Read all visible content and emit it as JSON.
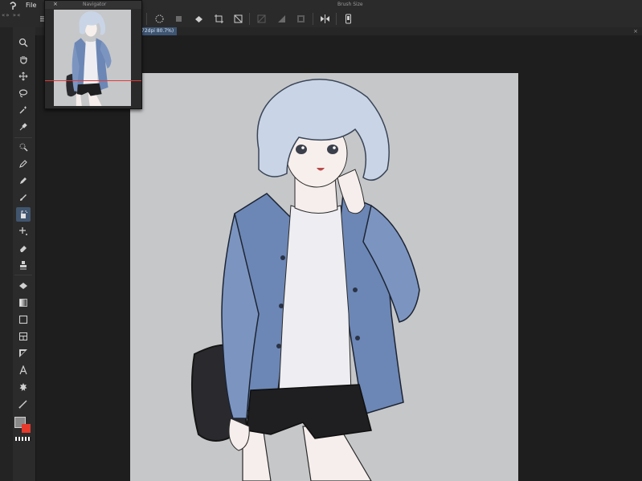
{
  "menubar": {
    "logo_icon": "clip-studio-logo-icon",
    "file_label": "File",
    "brush_size_title": "Brush Size"
  },
  "toolbar": {
    "arrows": "«» »«",
    "icons": [
      "hamburger-menu-icon",
      "select-lasso-icon",
      "undo-icon",
      "fill-bucket-icon",
      "crop-icon",
      "transform-icon",
      "deselect-icon",
      "gradient-icon",
      "layer-mask-icon",
      "flip-horizontal-icon",
      "phone-icon"
    ]
  },
  "tab": {
    "label": "72dpi 80.7%)",
    "close": "×"
  },
  "navigator": {
    "title": "Navigator",
    "close": "×"
  },
  "tools": [
    "zoom-icon",
    "hand-icon",
    "move-icon",
    "lasso-icon",
    "magic-wand-icon",
    "eyedropper-icon",
    "selection-pen-icon",
    "pen-icon",
    "pencil-icon",
    "brush-icon",
    "airbrush-icon",
    "decoration-icon",
    "eraser-icon",
    "blend-icon",
    "fill-icon",
    "gradient-icon",
    "figure-icon",
    "frame-icon",
    "ruler-icon",
    "text-icon",
    "balloon-icon",
    "correction-icon"
  ],
  "colors": {
    "main": "#8a8a8a",
    "sub": "#e53a2c",
    "canvas_bg": "#c6c7c9",
    "accent": "#41556e",
    "jacket": "#6c87b5",
    "shorts": "#1f1f22",
    "bag": "#2a2a2e",
    "hair": "#c9d5e6"
  }
}
